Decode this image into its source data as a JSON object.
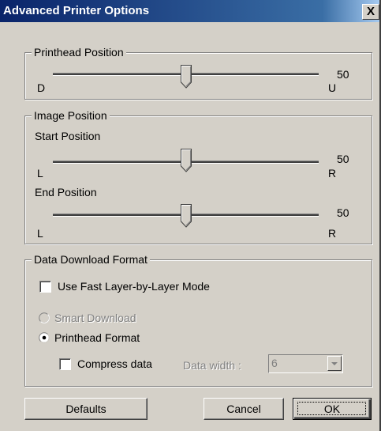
{
  "window": {
    "title": "Advanced Printer Options",
    "close_label": "X"
  },
  "printhead": {
    "legend": "Printhead Position",
    "min_label": "D",
    "max_label": "U",
    "value": "50"
  },
  "image": {
    "legend": "Image Position",
    "start": {
      "label": "Start Position",
      "min_label": "L",
      "max_label": "R",
      "value": "50"
    },
    "end": {
      "label": "End Position",
      "min_label": "L",
      "max_label": "R",
      "value": "50"
    }
  },
  "download": {
    "legend": "Data Download Format",
    "fast_layer_label": "Use Fast Layer-by-Layer Mode",
    "fast_layer_checked": false,
    "smart_download_label": "Smart Download",
    "smart_download_enabled": false,
    "printhead_format_label": "Printhead Format",
    "printhead_format_selected": true,
    "compress_label": "Compress data",
    "compress_checked": false,
    "data_width_label": "Data width :",
    "data_width_value": "6"
  },
  "buttons": {
    "defaults": "Defaults",
    "cancel": "Cancel",
    "ok": "OK"
  },
  "colors": {
    "titlebar": "#0a246a",
    "face": "#d4d0c8",
    "disabled_text": "#808080"
  }
}
